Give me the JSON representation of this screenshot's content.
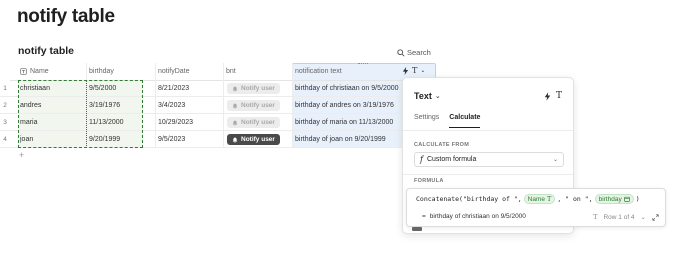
{
  "page": {
    "title": "notify table"
  },
  "table": {
    "title": "notify table",
    "search_label": "Search",
    "columns": {
      "name": "Name",
      "birthday": "birthday",
      "notifyDate": "notifyDate",
      "bnt": "bnt",
      "notification": "notification text"
    },
    "rows": [
      {
        "num": "1",
        "name": "christiaan",
        "birthday": "9/5/2000",
        "notifyDate": "8/21/2023",
        "bnt": "Notify user",
        "bnt_state": "disabled",
        "notification": "birthday of christiaan on 9/5/2000"
      },
      {
        "num": "2",
        "name": "andres",
        "birthday": "3/19/1976",
        "notifyDate": "3/4/2023",
        "bnt": "Notify user",
        "bnt_state": "disabled",
        "notification": "birthday of andres on 3/19/1976"
      },
      {
        "num": "3",
        "name": "maria",
        "birthday": "11/13/2000",
        "notifyDate": "10/29/2023",
        "bnt": "Notify user",
        "bnt_state": "disabled",
        "notification": "birthday of maria on 11/13/2000"
      },
      {
        "num": "4",
        "name": "joan",
        "birthday": "9/20/1999",
        "notifyDate": "9/5/2023",
        "bnt": "Notify user",
        "bnt_state": "active",
        "notification": "birthday of joan on 9/20/1999"
      }
    ],
    "add_row_label": "+"
  },
  "panel": {
    "title": "Text",
    "tabs": [
      "Settings",
      "Calculate"
    ],
    "active_tab": "Calculate",
    "calculate_from_label": "CALCULATE FROM",
    "calculate_from_value": "Custom formula",
    "formula_label": "FORMULA"
  },
  "formula": {
    "prefix": "Concatenate(\"birthday of \", ",
    "chip1": "Name",
    "middle": ", \" on \", ",
    "chip2": "birthday",
    "suffix": ")",
    "result_prefix": "=",
    "result": "birthday of christiaan on 9/5/2000",
    "row_label": "Row 1 of 4"
  },
  "colors": {
    "selection_border": "#2e7d32",
    "selection_bg": "#f1f6ee",
    "column_highlight": "#e8f1fb",
    "chip_bg": "#e6f4e6",
    "chip_text": "#2e7d32",
    "notify_active": "#4a4a4a"
  },
  "icons": {
    "search": "search-icon",
    "name_col": "text-field-icon",
    "bolt": "lightning-icon",
    "text_type": "text-type-icon",
    "chevron": "chevron-down-icon",
    "bell": "bell-icon",
    "formula": "function-icon",
    "expand": "expand-icon"
  }
}
